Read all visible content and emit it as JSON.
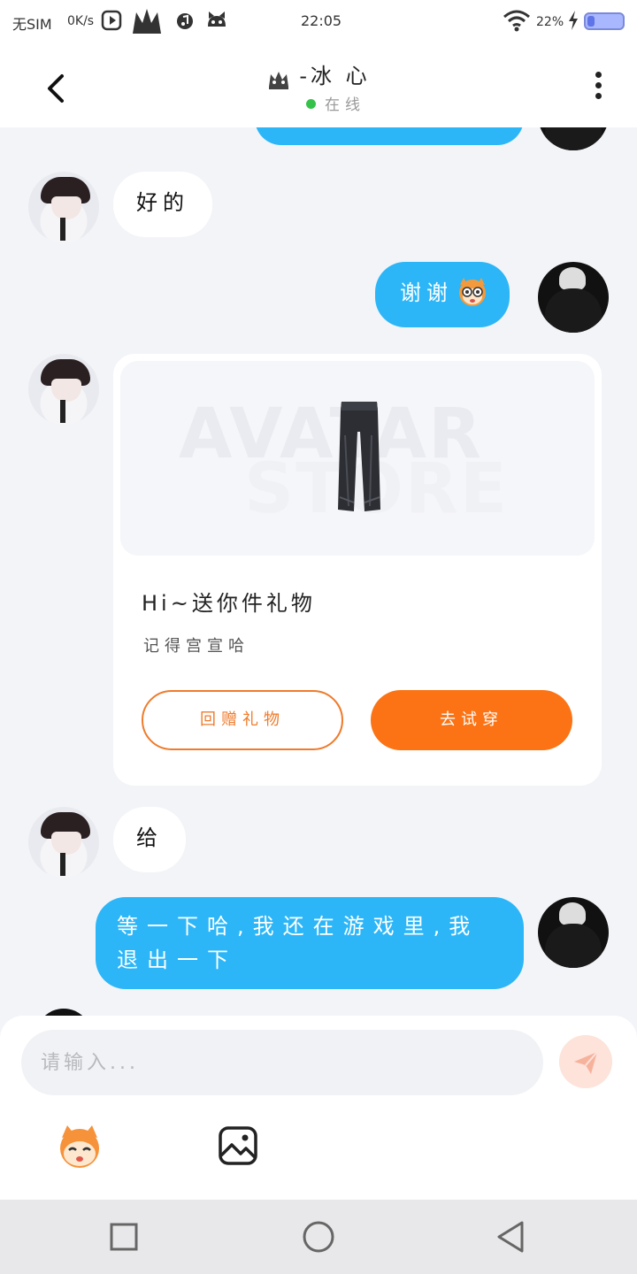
{
  "status_bar": {
    "carrier": "无SIM",
    "speed": "0K/s",
    "time": "22:05",
    "battery": "22%",
    "battery_level": 0.22
  },
  "header": {
    "title": "-冰 心",
    "status": "在线"
  },
  "messages": [
    {
      "side": "left",
      "text": "好的"
    },
    {
      "side": "right",
      "text": "谢谢"
    },
    {
      "side": "left",
      "type": "gift",
      "title": "Hi~送你件礼物",
      "subtitle": "记得宫宣哈",
      "watermark_top": "AVATAR",
      "watermark_bottom": "STORE",
      "button_return": "回赠礼物",
      "button_try": "去试穿"
    },
    {
      "side": "left",
      "text": "给"
    },
    {
      "side": "right",
      "text": "等一下哈,我还在游戏里,我退出一下"
    }
  ],
  "input": {
    "placeholder": "请输入..."
  },
  "colors": {
    "bubble_right": "#2cb6f7",
    "accent_orange": "#fb7314",
    "online_green": "#35c24a"
  }
}
